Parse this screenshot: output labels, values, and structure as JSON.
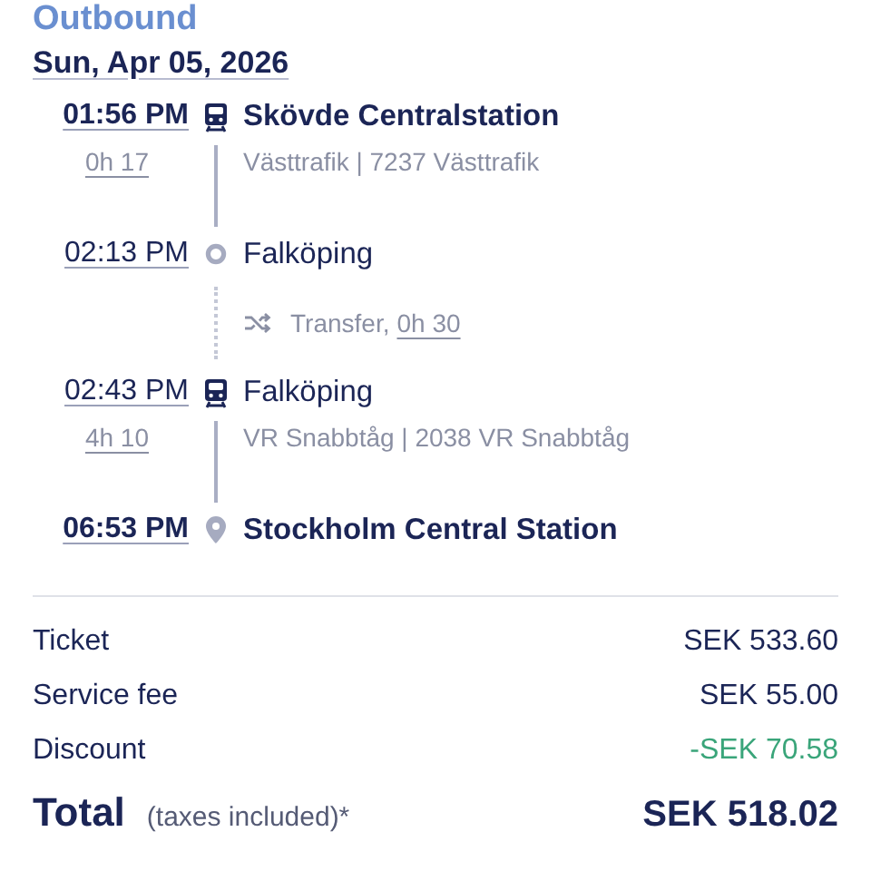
{
  "heading": "Outbound",
  "date": "Sun, Apr 05, 2026",
  "timeline": [
    {
      "kind": "board",
      "time": "01:56 PM",
      "place": "Skövde Centralstation",
      "bold": true
    },
    {
      "kind": "leg",
      "duration": "0h 17",
      "operator": "Västtrafik | 7237 Västtrafik"
    },
    {
      "kind": "alight",
      "time": "02:13 PM",
      "place": "Falköping",
      "bold": false
    },
    {
      "kind": "transfer",
      "label": "Transfer,",
      "duration": "0h 30"
    },
    {
      "kind": "board",
      "time": "02:43 PM",
      "place": "Falköping",
      "bold": false
    },
    {
      "kind": "leg",
      "duration": "4h 10",
      "operator": "VR Snabbtåg | 2038 VR Snabbtåg"
    },
    {
      "kind": "destination",
      "time": "06:53 PM",
      "place": "Stockholm Central Station",
      "bold": true
    }
  ],
  "prices": [
    {
      "label": "Ticket",
      "value": "SEK 533.60",
      "kind": "normal"
    },
    {
      "label": "Service fee",
      "value": "SEK 55.00",
      "kind": "normal"
    },
    {
      "label": "Discount",
      "value": "-SEK 70.58",
      "kind": "discount"
    }
  ],
  "total": {
    "label": "Total",
    "note": "(taxes included)*",
    "value": "SEK 518.02"
  }
}
